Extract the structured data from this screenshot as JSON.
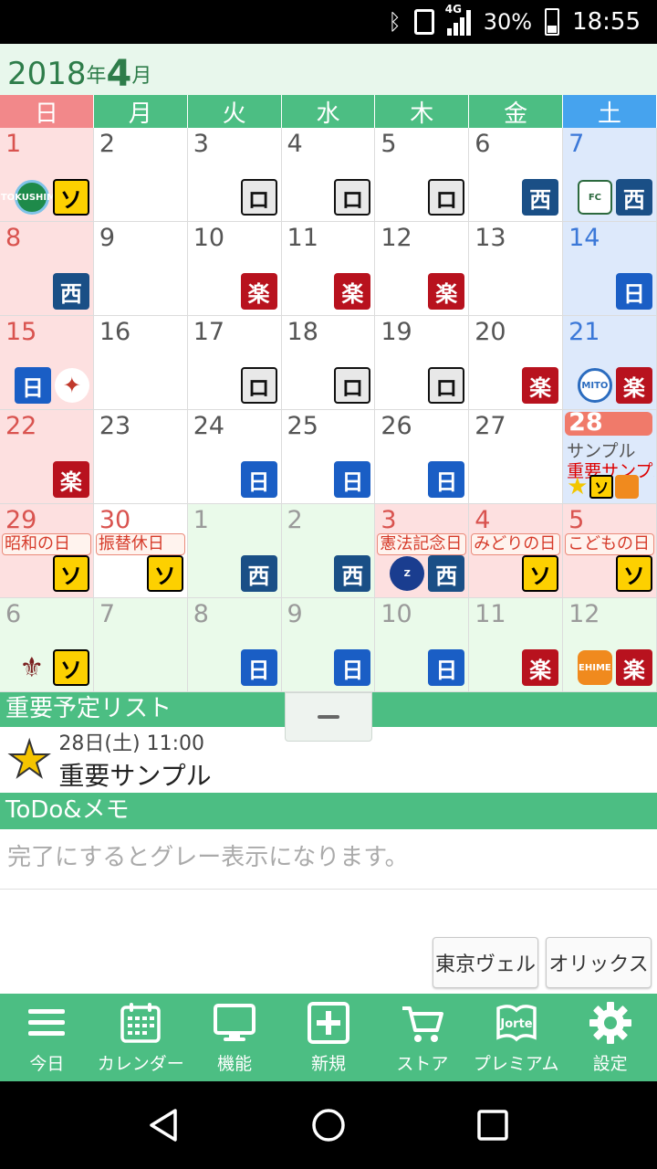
{
  "status_bar": {
    "network": "4G",
    "battery": "30%",
    "time": "18:55"
  },
  "month_header": {
    "year": "2018",
    "year_suffix": "年",
    "month": "4",
    "month_suffix": "月"
  },
  "weekdays": [
    "日",
    "月",
    "火",
    "水",
    "木",
    "金",
    "土"
  ],
  "calendar": {
    "weeks": [
      [
        {
          "day": "1",
          "kind": "sun",
          "badges": [
            "logo-green:TOKUSHIMA",
            "so:ソ"
          ]
        },
        {
          "day": "2",
          "kind": "",
          "badges": []
        },
        {
          "day": "3",
          "kind": "",
          "badges": [
            "ro:ロ"
          ]
        },
        {
          "day": "4",
          "kind": "",
          "badges": [
            "ro:ロ"
          ]
        },
        {
          "day": "5",
          "kind": "",
          "badges": [
            "ro:ロ"
          ]
        },
        {
          "day": "6",
          "kind": "",
          "badges": [
            "nishi:西"
          ]
        },
        {
          "day": "7",
          "kind": "sat",
          "badges": [
            "logo-crest:FC",
            "nishi:西"
          ]
        }
      ],
      [
        {
          "day": "8",
          "kind": "sun",
          "badges": [
            "nishi:西"
          ]
        },
        {
          "day": "9",
          "kind": "",
          "badges": []
        },
        {
          "day": "10",
          "kind": "",
          "badges": [
            "raku:楽"
          ]
        },
        {
          "day": "11",
          "kind": "",
          "badges": [
            "raku:楽"
          ]
        },
        {
          "day": "12",
          "kind": "",
          "badges": [
            "raku:楽"
          ]
        },
        {
          "day": "13",
          "kind": "",
          "badges": []
        },
        {
          "day": "14",
          "kind": "sat",
          "badges": [
            "nichi:日"
          ]
        }
      ],
      [
        {
          "day": "15",
          "kind": "sun",
          "badges": [
            "nichi:日",
            "logo-bird:✦"
          ]
        },
        {
          "day": "16",
          "kind": "",
          "badges": []
        },
        {
          "day": "17",
          "kind": "",
          "badges": [
            "ro:ロ"
          ]
        },
        {
          "day": "18",
          "kind": "",
          "badges": [
            "ro:ロ"
          ]
        },
        {
          "day": "19",
          "kind": "",
          "badges": [
            "ro:ロ"
          ]
        },
        {
          "day": "20",
          "kind": "",
          "badges": [
            "raku:楽"
          ]
        },
        {
          "day": "21",
          "kind": "sat",
          "badges": [
            "logo-stripe:MITO",
            "raku:楽"
          ]
        }
      ],
      [
        {
          "day": "22",
          "kind": "sun",
          "badges": [
            "raku:楽"
          ]
        },
        {
          "day": "23",
          "kind": "",
          "badges": []
        },
        {
          "day": "24",
          "kind": "",
          "badges": [
            "nichi:日"
          ]
        },
        {
          "day": "25",
          "kind": "",
          "badges": [
            "nichi:日"
          ]
        },
        {
          "day": "26",
          "kind": "",
          "badges": [
            "nichi:日"
          ]
        },
        {
          "day": "27",
          "kind": "",
          "badges": []
        },
        {
          "day": "28",
          "kind": "sat today",
          "badges": [],
          "texts": [
            "サンプル",
            "重要サンプル"
          ]
        }
      ],
      [
        {
          "day": "29",
          "kind": "sun",
          "holiday": "昭和の日",
          "badges": [
            "so:ソ"
          ]
        },
        {
          "day": "30",
          "kind": "holiday",
          "holiday": "振替休日",
          "badges": [
            "so:ソ"
          ]
        },
        {
          "day": "1",
          "kind": "outside",
          "badges": [
            "nishi:西"
          ]
        },
        {
          "day": "2",
          "kind": "outside",
          "badges": [
            "nishi:西"
          ]
        },
        {
          "day": "3",
          "kind": "outside holiday",
          "holiday": "憲法記念日",
          "badges": [
            "logo-blue:Z",
            "nishi:西"
          ]
        },
        {
          "day": "4",
          "kind": "outside holiday",
          "holiday": "みどりの日",
          "badges": [
            "so:ソ"
          ]
        },
        {
          "day": "5",
          "kind": "outside holiday",
          "holiday": "こどもの日",
          "badges": [
            "so:ソ"
          ]
        }
      ],
      [
        {
          "day": "6",
          "kind": "outside",
          "badges": [
            "logo-fleur:⚜",
            "so:ソ"
          ]
        },
        {
          "day": "7",
          "kind": "outside",
          "badges": []
        },
        {
          "day": "8",
          "kind": "outside",
          "badges": [
            "nichi:日"
          ]
        },
        {
          "day": "9",
          "kind": "outside",
          "badges": [
            "nichi:日"
          ]
        },
        {
          "day": "10",
          "kind": "outside",
          "badges": [
            "nichi:日"
          ]
        },
        {
          "day": "11",
          "kind": "outside",
          "badges": [
            "raku:楽"
          ]
        },
        {
          "day": "12",
          "kind": "outside",
          "badges": [
            "logo-orange:EHIME",
            "raku:楽"
          ]
        }
      ]
    ]
  },
  "important_list": {
    "header": "重要予定リスト",
    "items": [
      {
        "time": "28日(土) 11:00",
        "title": "重要サンプル"
      }
    ]
  },
  "todo": {
    "header": "ToDo&メモ",
    "hint": "完了にするとグレー表示になります。"
  },
  "team_buttons": [
    "東京ヴェル",
    "オリックス"
  ],
  "toolbar": {
    "items": [
      {
        "label": "今日",
        "icon": "menu-icon"
      },
      {
        "label": "カレンダー",
        "icon": "calendar-icon"
      },
      {
        "label": "機能",
        "icon": "monitor-icon"
      },
      {
        "label": "新規",
        "icon": "add-icon"
      },
      {
        "label": "ストア",
        "icon": "cart-icon"
      },
      {
        "label": "プレミアム",
        "icon": "jorte-icon",
        "icon_text": "Jorte"
      },
      {
        "label": "設定",
        "icon": "gear-icon"
      }
    ]
  },
  "colors": {
    "accent_green": "#4cbe83",
    "sunday_red": "#f2888a",
    "saturday_blue": "#46a3ee"
  }
}
